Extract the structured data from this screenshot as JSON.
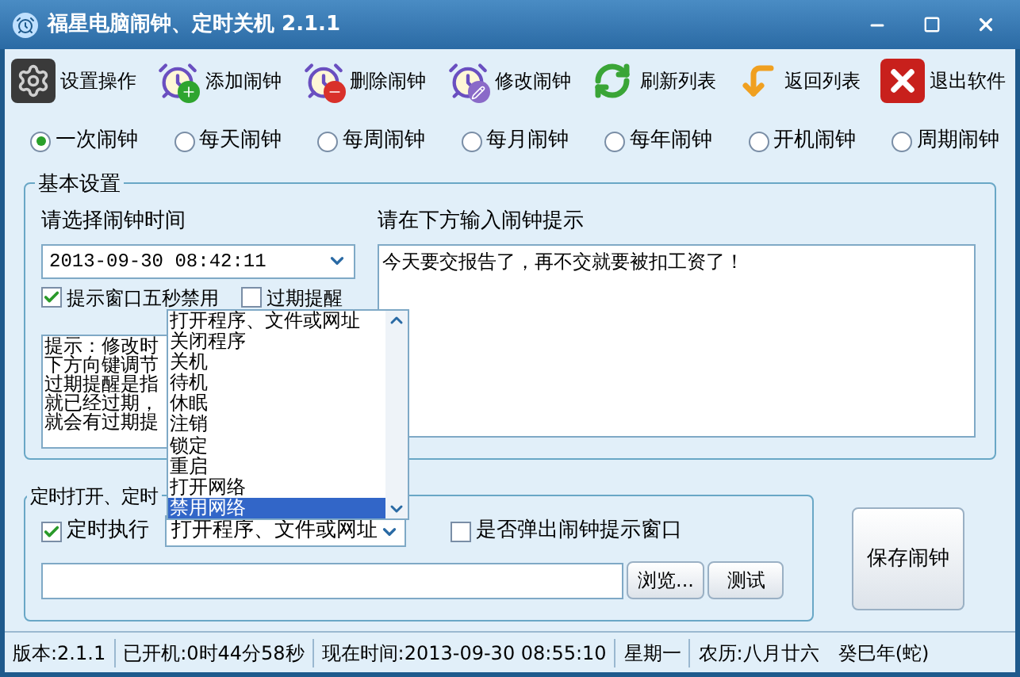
{
  "window": {
    "title": "福星电脑闹钟、定时关机 2.1.1"
  },
  "toolbar": [
    {
      "kind": "gear",
      "label": "设置操作"
    },
    {
      "kind": "add",
      "label": "添加闹钟"
    },
    {
      "kind": "delete",
      "label": "删除闹钟"
    },
    {
      "kind": "edit",
      "label": "修改闹钟"
    },
    {
      "kind": "refresh",
      "label": "刷新列表"
    },
    {
      "kind": "back",
      "label": "返回列表"
    },
    {
      "kind": "exit",
      "label": "退出软件"
    }
  ],
  "alarm_types": [
    {
      "label": "一次闹钟",
      "selected": true
    },
    {
      "label": "每天闹钟",
      "selected": false
    },
    {
      "label": "每周闹钟",
      "selected": false
    },
    {
      "label": "每月闹钟",
      "selected": false
    },
    {
      "label": "每年闹钟",
      "selected": false
    },
    {
      "label": "开机闹钟",
      "selected": false
    },
    {
      "label": "周期闹钟",
      "selected": false
    }
  ],
  "basic": {
    "title": "基本设置",
    "time_label": "请选择闹钟时间",
    "time_value": "2013-09-30 08:42:11",
    "options": [
      {
        "label": "提示窗口五秒禁用",
        "checked": true
      },
      {
        "label": "过期提醒",
        "checked": false
      }
    ],
    "hint_lines": [
      "提示：修改时",
      "下方向键调节",
      "过期提醒是指",
      "就已经过期，",
      "就会有过期提"
    ],
    "message_label": "请在下方输入闹钟提示",
    "message_value": "今天要交报告了，再不交就要被扣工资了！"
  },
  "timed": {
    "title": "定时打开、定时",
    "execute": {
      "label": "定时执行",
      "checked": true
    },
    "action": "打开程序、文件或网址",
    "popup": {
      "label": "是否弹出闹钟提示窗口",
      "checked": false
    },
    "browse": "浏览...",
    "test": "测试"
  },
  "action_list": [
    {
      "label": "打开程序、文件或网址",
      "selected": false
    },
    {
      "label": "关闭程序",
      "selected": false
    },
    {
      "label": "关机",
      "selected": false
    },
    {
      "label": "待机",
      "selected": false
    },
    {
      "label": "休眠",
      "selected": false
    },
    {
      "label": "注销",
      "selected": false
    },
    {
      "label": "锁定",
      "selected": false
    },
    {
      "label": "重启",
      "selected": false
    },
    {
      "label": "打开网络",
      "selected": false
    },
    {
      "label": "禁用网络",
      "selected": true
    }
  ],
  "save_button": "保存闹钟",
  "status_bar": [
    "版本:2.1.1",
    "已开机:0时44分58秒",
    "现在时间:2013-09-30 08:55:10",
    "星期一",
    "农历:八月廿六　癸巳年(蛇)"
  ]
}
